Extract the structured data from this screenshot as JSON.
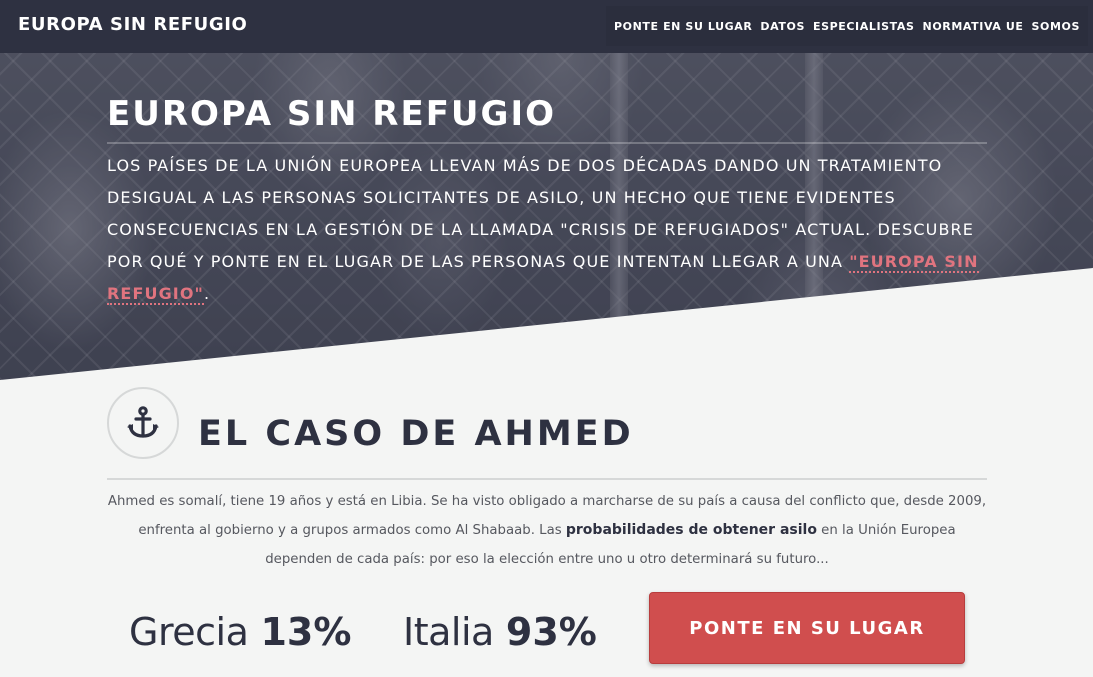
{
  "header": {
    "brand": "EUROPA SIN REFUGIO",
    "nav": [
      {
        "label": "PONTE EN SU LUGAR"
      },
      {
        "label": "DATOS"
      },
      {
        "label": "ESPECIALISTAS"
      },
      {
        "label": "NORMATIVA UE"
      },
      {
        "label": "SOMOS"
      }
    ]
  },
  "hero": {
    "title": "EUROPA SIN REFUGIO",
    "text_before_link": "Los países de la Unión Europea llevan más de dos décadas dando un tratamiento desigual a las personas solicitantes de asilo, un hecho que tiene evidentes consecuencias en la gestión de la llamada \"crisis de refugiados\" actual. Descubre por qué y ponte en el lugar de las personas que intentan llegar a una ",
    "link_label": "\"Europa sin refugio\"",
    "text_after_link": "."
  },
  "case": {
    "icon": "anchor-icon",
    "title": "EL CASO DE AHMED",
    "body_part1": "Ahmed es somalí, tiene 19 años y está en Libia. Se ha visto obligado a marcharse de su país a causa del conflicto que, desde 2009, enfrenta al gobierno y a grupos armados como Al Shabaab. Las ",
    "body_bold": "probabilidades de obtener asilo",
    "body_part2": " en la Unión Europea dependen de cada país: por eso la elección entre uno u otro determinará su futuro...",
    "stats": [
      {
        "country": "Grecia",
        "value": "13%"
      },
      {
        "country": "Italia",
        "value": "93%"
      }
    ],
    "cta_label": "PONTE EN SU LUGAR"
  },
  "colors": {
    "navy": "#2e3141",
    "accent_red": "#d04e4e",
    "link_pink": "#e0747f",
    "page_bg": "#f4f5f4"
  }
}
